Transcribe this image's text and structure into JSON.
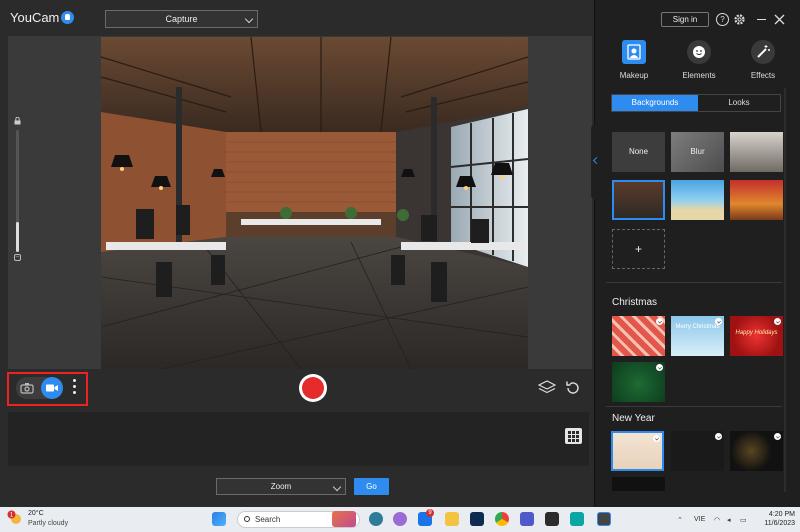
{
  "app": {
    "title": "YouCam"
  },
  "header": {
    "capture_label": "Capture",
    "signin_label": "Sign in",
    "help_label": "?"
  },
  "tabs": [
    {
      "label": "Makeup",
      "icon": "makeup-icon"
    },
    {
      "label": "Elements",
      "icon": "elements-icon"
    },
    {
      "label": "Effects",
      "icon": "effects-icon"
    }
  ],
  "sub_tabs": {
    "backgrounds": "Backgrounds",
    "looks": "Looks"
  },
  "backgrounds": {
    "none_label": "None",
    "blur_label": "Blur",
    "add_label": "+"
  },
  "sections": {
    "christmas": "Christmas",
    "new_year": "New Year"
  },
  "christmas_thumbs": {
    "merry_text": "Merry Christmas",
    "happy_text": "Happy Holidays"
  },
  "zoom": {
    "label": "Zoom",
    "go_label": "Go"
  },
  "taskbar": {
    "weather_temp": "20°C",
    "weather_desc": "Partly cloudy",
    "weather_badge": "1",
    "search_label": "Search",
    "mail_badge": "9",
    "lang": "VIE",
    "time": "4:20 PM",
    "date": "11/6/2023"
  },
  "colors": {
    "accent": "#2e8cf0",
    "record": "#e52b2b",
    "highlight": "#e22222"
  }
}
